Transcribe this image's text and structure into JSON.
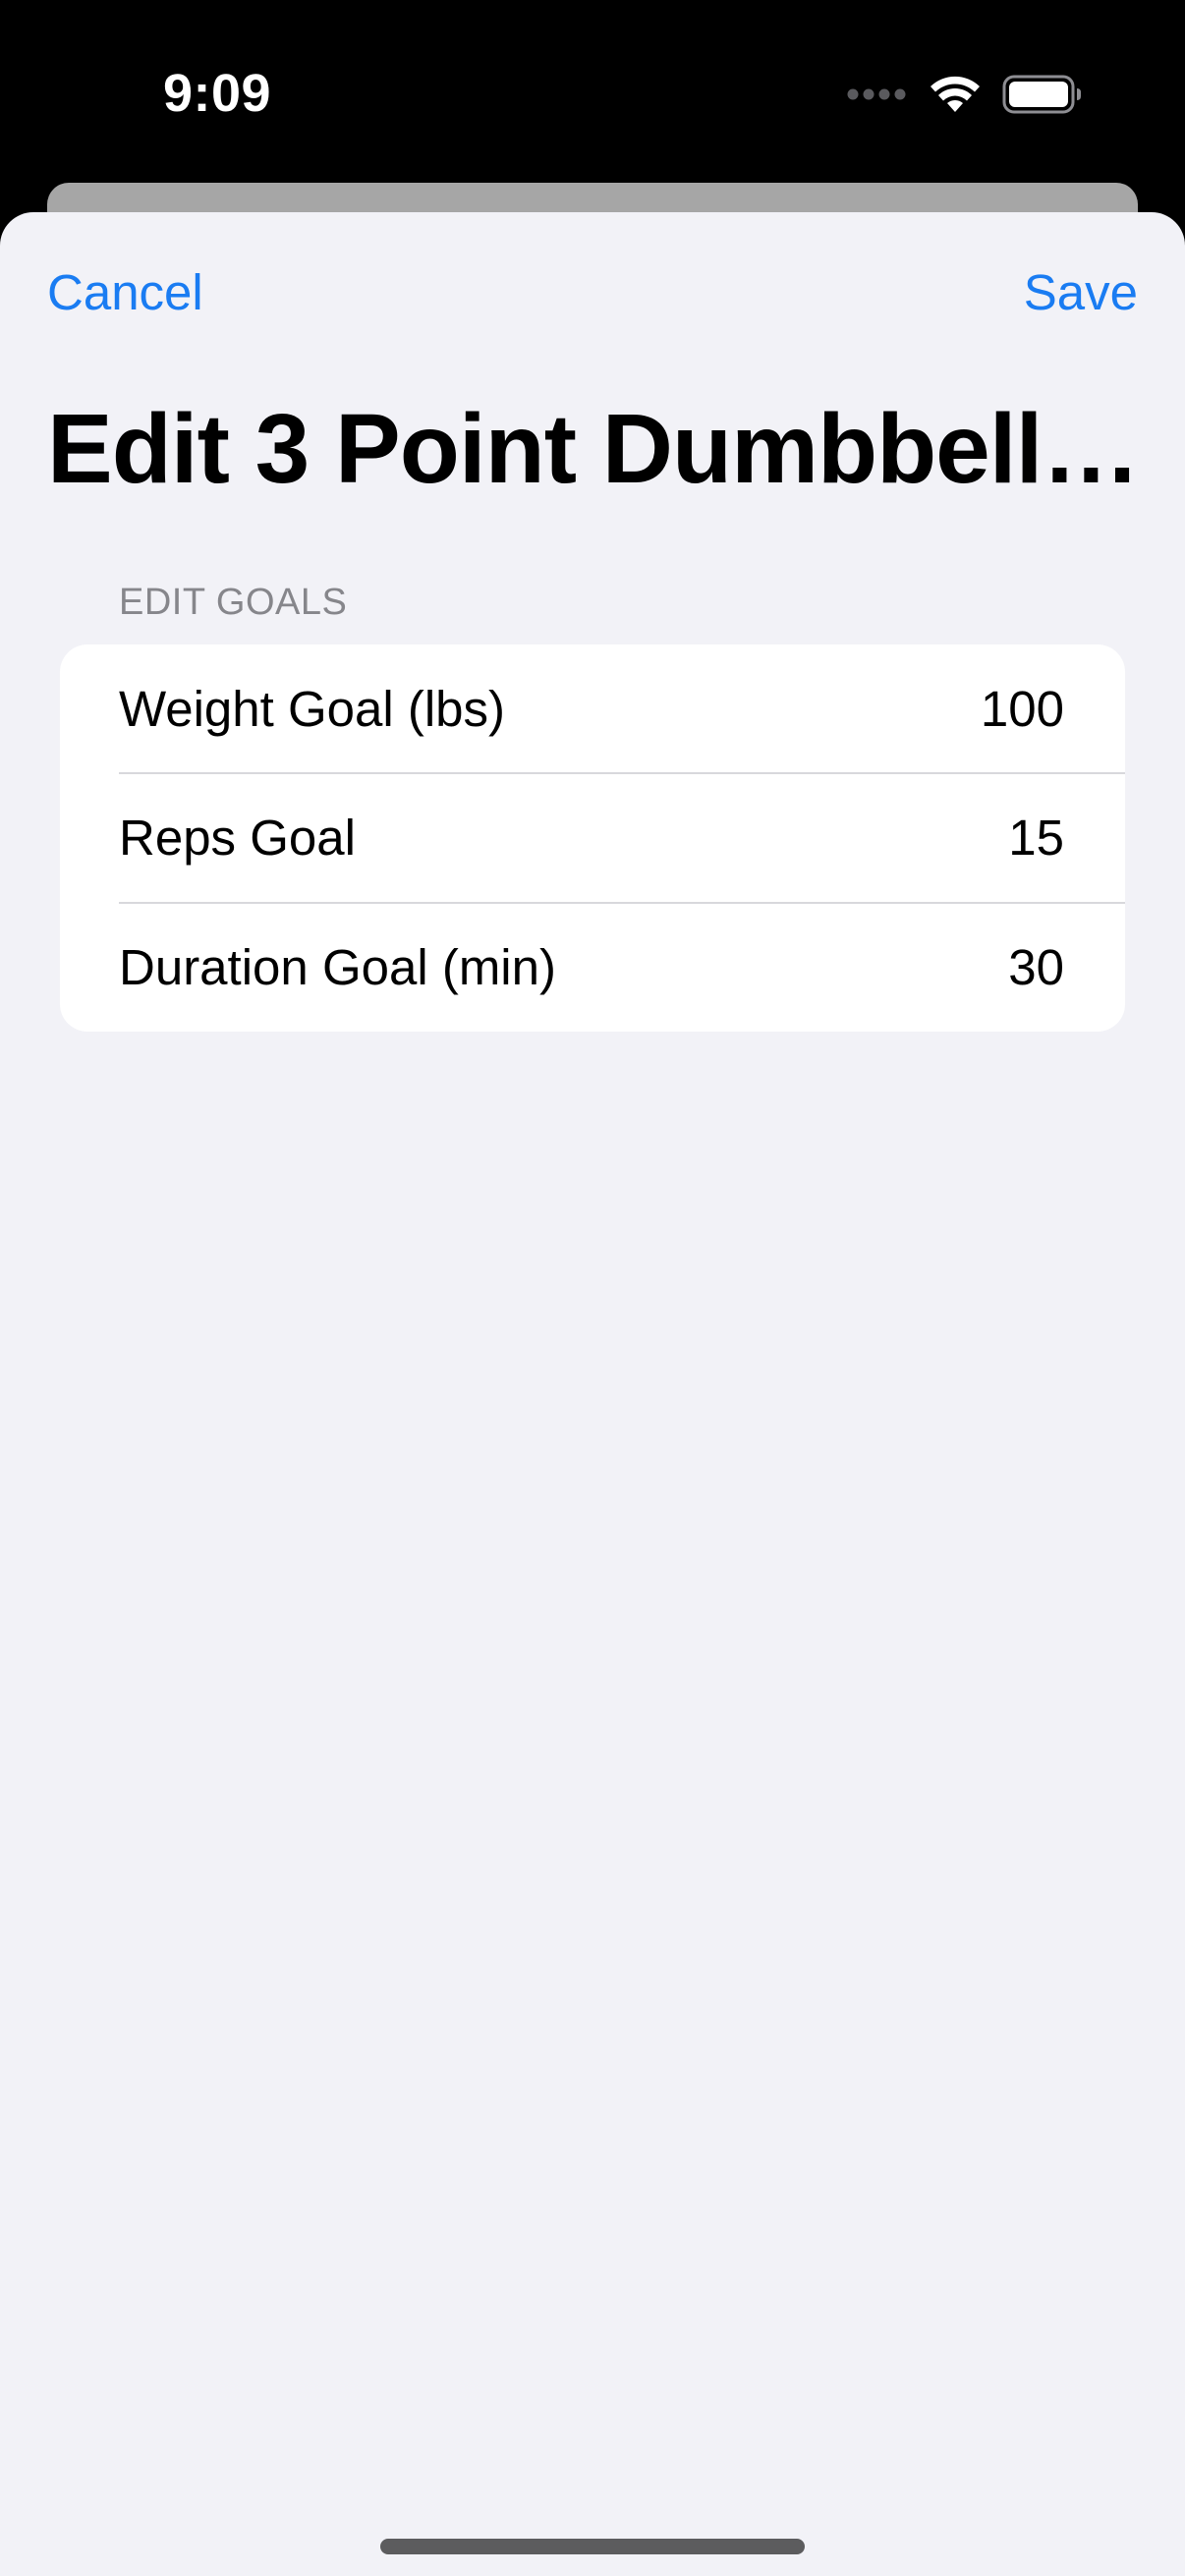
{
  "status_bar": {
    "time": "9:09",
    "icons": [
      "signal-dots-icon",
      "wifi-icon",
      "battery-icon"
    ]
  },
  "nav": {
    "cancel_label": "Cancel",
    "save_label": "Save"
  },
  "title": "Edit 3 Point Dumbbell…",
  "section": {
    "header": "EDIT GOALS",
    "rows": [
      {
        "label": "Weight Goal (lbs)",
        "value": "100"
      },
      {
        "label": "Reps Goal",
        "value": "15"
      },
      {
        "label": "Duration Goal (min)",
        "value": "30"
      }
    ]
  },
  "colors": {
    "accent": "#1a7cf2",
    "background": "#f2f2f7",
    "card": "#ffffff",
    "secondary_text": "#86868b"
  }
}
